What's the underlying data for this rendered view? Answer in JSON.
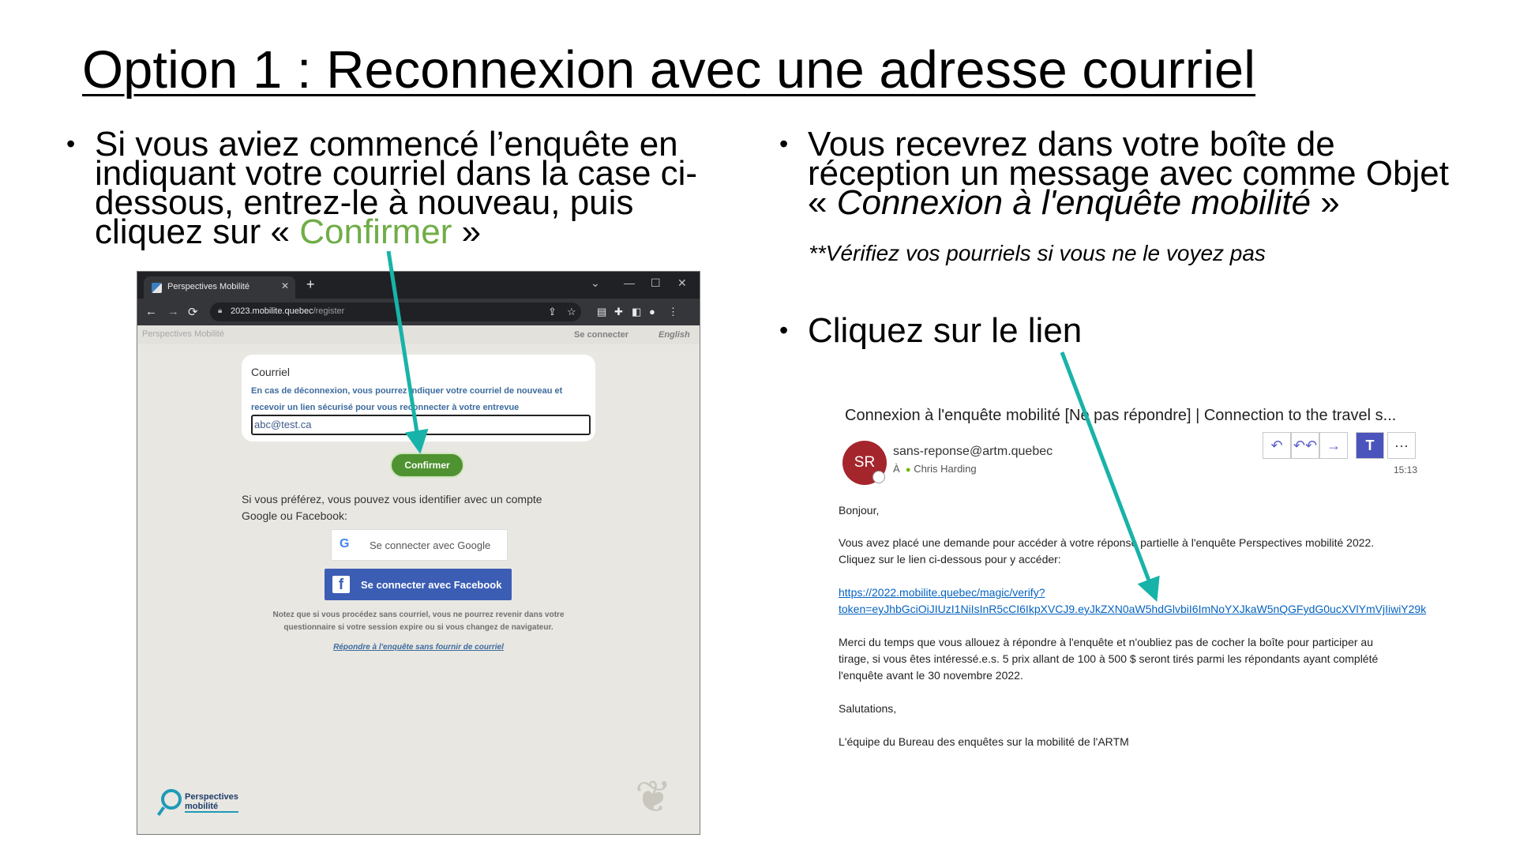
{
  "slide": {
    "title": "Option 1 : Reconnexion avec une adresse courriel",
    "left_bullet": {
      "line1": "Si vous aviez commencé l’enquête en",
      "line2": "indiquant votre courriel dans la case ci-",
      "line3": "dessous, entrez-le à nouveau, puis",
      "line4_prefix": "cliquez sur « ",
      "line4_highlight": "Confirmer",
      "line4_suffix": " »"
    },
    "right_bullet1": {
      "line1": "Vous recevrez dans votre boîte de",
      "line2": "réception un message avec comme Objet",
      "line3_open": "« ",
      "line3_italic": "Connexion à l'enquête mobilité",
      "line3_close": " »"
    },
    "note": "**Vérifiez vos pourriels si vous ne le voyez pas",
    "right_bullet2": "Cliquez sur le lien",
    "bullet_char": "•",
    "arrow_color": "#18b3a8"
  },
  "browser": {
    "tab_title": "Perspectives Mobilité",
    "tab_close": "✕",
    "new_tab": "+",
    "win_controls": [
      "⌄",
      "—",
      "☐",
      "✕"
    ],
    "nav": [
      "←",
      "→",
      "⟳"
    ],
    "url_host": "2023.mobilite.quebec",
    "url_path": "/register",
    "toolbar_icons": [
      "⇪",
      "☆",
      "▤",
      "✚",
      "◧",
      "●",
      "⋮"
    ]
  },
  "site": {
    "brand": "Perspectives Mobilité",
    "signin": "Se connecter",
    "language": "English",
    "email_label": "Courriel",
    "email_help": "En cas de déconnexion, vous pourrez indiquer votre courriel de nouveau et recevoir un lien sécurisé pour vous reconnecter à votre entrevue",
    "email_value": "abc@test.ca",
    "confirm_label": "Confirmer",
    "alt_text": "Si vous préférez, vous pouvez vous identifier avec un compte Google ou Facebook:",
    "google_label": "Se connecter avec Google",
    "facebook_label": "Se connecter avec Facebook",
    "disclaimer": "Notez que si vous procédez sans courriel, vous ne pourrez revenir dans votre questionnaire si votre session expire ou si vous changez de navigateur.",
    "no_email_link": "Répondre à l'enquête sans fournir de courriel",
    "logo_line1": "Perspectives",
    "logo_line2": "mobilité"
  },
  "email": {
    "subject": "Connexion à l'enquête mobilité [Ne pas répondre] | Connection to the travel s...",
    "avatar_initials": "SR",
    "sender": "sans-reponse@artm.quebec",
    "to_prefix": "À",
    "to_name": "Chris Harding",
    "time": "15:13",
    "actions": [
      "↶",
      "↶↶",
      "→",
      "T",
      "···"
    ],
    "greeting": "Bonjour,",
    "para1_line1": "Vous avez placé une demande pour accéder à votre réponse partielle à l'enquête Perspectives mobilité 2022.",
    "para1_line2": "Cliquez sur le lien ci-dessous pour y accéder:",
    "link_line1": "https://2022.mobilite.quebec/magic/verify?",
    "link_line2": "token=eyJhbGciOiJIUzI1NiIsInR5cCI6IkpXVCJ9.eyJkZXN0aW5hdGlvbiI6ImNoYXJkaW5nQGFydG0ucXVlYmVjIiwiY29k",
    "para2_line1": "Merci du temps que vous allouez à répondre à l'enquête et n'oubliez pas de cocher la boîte pour participer au",
    "para2_line2": "tirage, si vous êtes intéressé.e.s. 5 prix allant de 100 à 500 $ seront tirés parmi les répondants ayant complété",
    "para2_line3": "l'enquête avant le 30 novembre 2022.",
    "closing": "Salutations,",
    "signature": "L'équipe du Bureau des enquêtes sur la mobilité de l'ARTM"
  }
}
